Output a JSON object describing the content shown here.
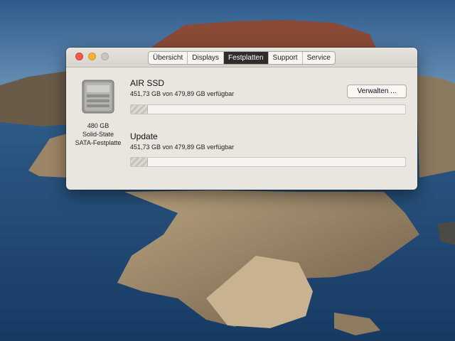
{
  "window": {
    "tabs": [
      {
        "label": "Übersicht",
        "active": false
      },
      {
        "label": "Displays",
        "active": false
      },
      {
        "label": "Festplatten",
        "active": true
      },
      {
        "label": "Support",
        "active": false
      },
      {
        "label": "Service",
        "active": false
      }
    ]
  },
  "disk": {
    "icon": "hard-drive-icon",
    "caption_line1": "480 GB",
    "caption_line2": "Solid-State",
    "caption_line3": "SATA-Festplatte"
  },
  "volumes": [
    {
      "name": "AIR SSD",
      "info": "451,73 GB von 479,89 GB verfügbar",
      "used_fraction": 0.06,
      "button_label": "Verwalten ..."
    },
    {
      "name": "Update",
      "info": "451,73 GB von 479,89 GB verfügbar",
      "used_fraction": 0.06
    }
  ],
  "colors": {
    "active_tab": "#2e2d2b",
    "close_light": "#f25a52",
    "minimize_light": "#f2b33a"
  }
}
